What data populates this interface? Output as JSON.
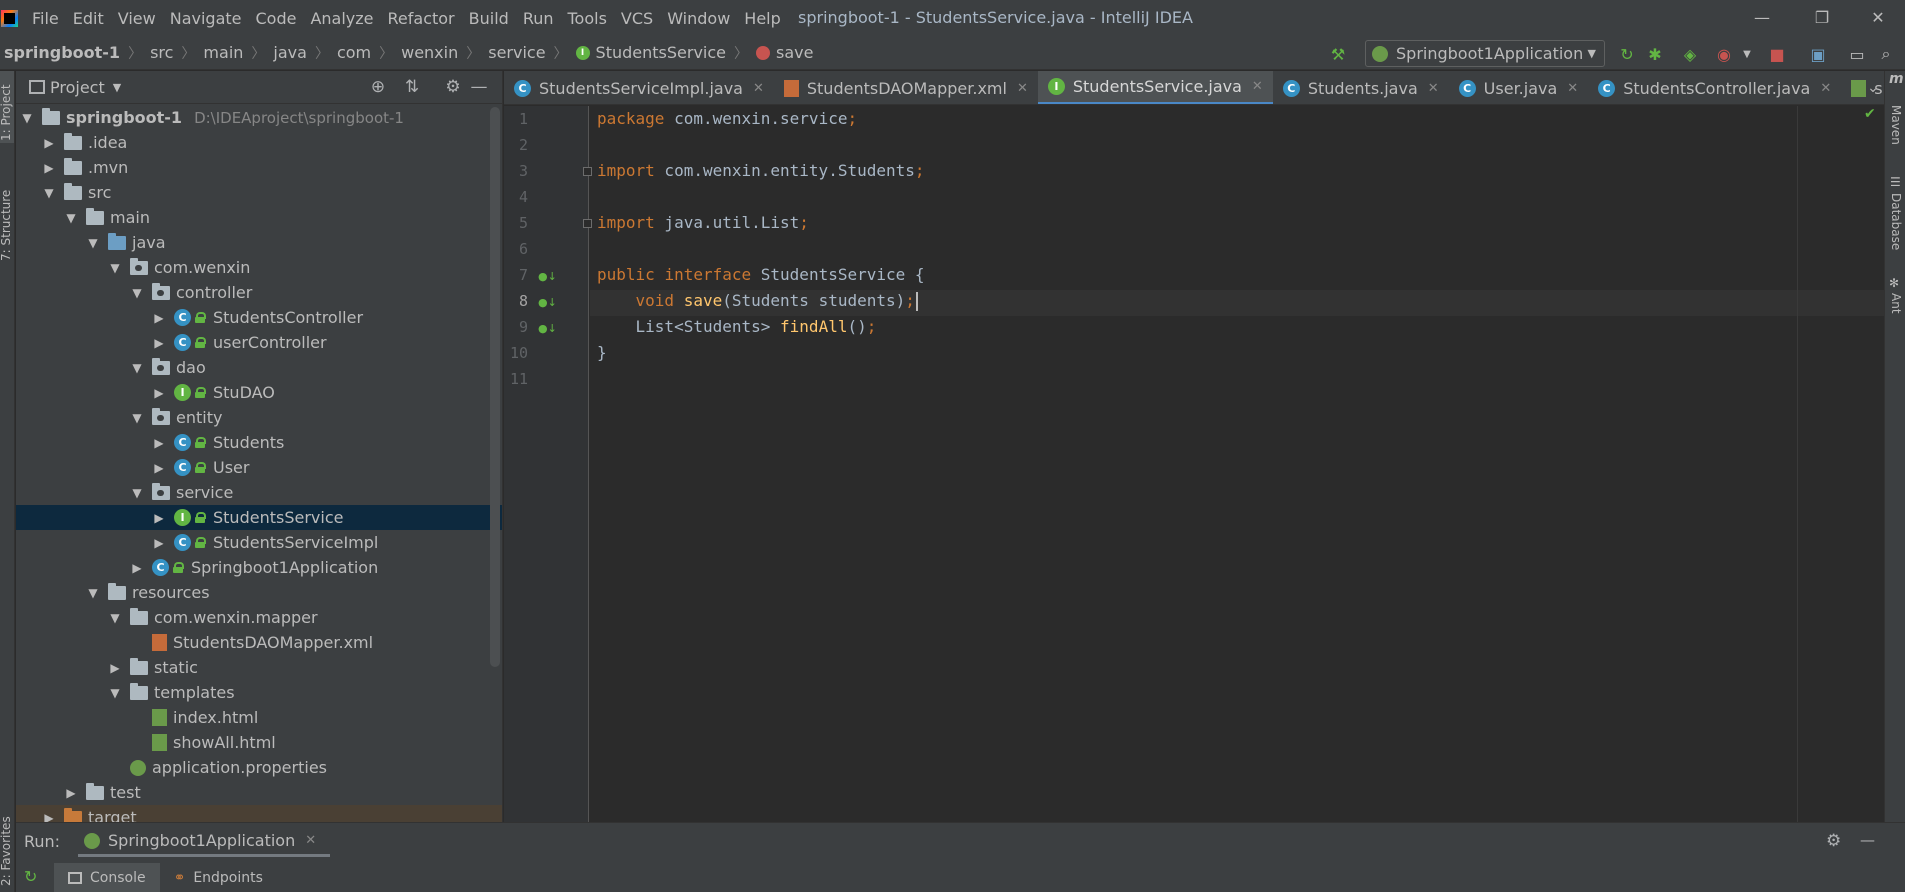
{
  "window": {
    "title": "springboot-1 - StudentsService.java - IntelliJ IDEA",
    "controls": [
      "—",
      "❐",
      "✕"
    ]
  },
  "menu": [
    "File",
    "Edit",
    "View",
    "Navigate",
    "Code",
    "Analyze",
    "Refactor",
    "Build",
    "Run",
    "Tools",
    "VCS",
    "Window",
    "Help"
  ],
  "breadcrumb": [
    "springboot-1",
    "src",
    "main",
    "java",
    "com",
    "wenxin",
    "service",
    "StudentsService",
    "save"
  ],
  "toolbar": {
    "run_config": "Springboot1Application"
  },
  "left_strip": {
    "tabs": [
      "1: Project",
      "7: Structure",
      "2: Favorites"
    ]
  },
  "project_panel": {
    "title": "Project",
    "tree": [
      {
        "label": "springboot-1",
        "path": "D:\\IDEAproject\\springboot-1"
      },
      {
        "label": ".idea"
      },
      {
        "label": ".mvn"
      },
      {
        "label": "src"
      },
      {
        "label": "main"
      },
      {
        "label": "java"
      },
      {
        "label": "com.wenxin"
      },
      {
        "label": "controller"
      },
      {
        "label": "StudentsController"
      },
      {
        "label": "userController"
      },
      {
        "label": "dao"
      },
      {
        "label": "StuDAO"
      },
      {
        "label": "entity"
      },
      {
        "label": "Students"
      },
      {
        "label": "User"
      },
      {
        "label": "service"
      },
      {
        "label": "StudentsService"
      },
      {
        "label": "StudentsServiceImpl"
      },
      {
        "label": "Springboot1Application"
      },
      {
        "label": "resources"
      },
      {
        "label": "com.wenxin.mapper"
      },
      {
        "label": "StudentsDAOMapper.xml"
      },
      {
        "label": "static"
      },
      {
        "label": "templates"
      },
      {
        "label": "index.html"
      },
      {
        "label": "showAll.html"
      },
      {
        "label": "application.properties"
      },
      {
        "label": "test"
      },
      {
        "label": "target"
      }
    ]
  },
  "editor_tabs": [
    {
      "label": "StudentsServiceImpl.java"
    },
    {
      "label": "StudentsDAOMapper.xml"
    },
    {
      "label": "StudentsService.java"
    },
    {
      "label": "Students.java"
    },
    {
      "label": "User.java"
    },
    {
      "label": "StudentsController.java"
    },
    {
      "label": "showAll.htr"
    }
  ],
  "editor": {
    "line_numbers": [
      "1",
      "2",
      "3",
      "4",
      "5",
      "6",
      "7",
      "8",
      "9",
      "10",
      "11"
    ],
    "code": {
      "l1_kw": "package",
      "l1_rest": " com.wenxin.service",
      "semi": ";",
      "l3_kw": "import",
      "l3_rest": " com.wenxin.entity.Students",
      "l5_kw": "import",
      "l5_rest": " java.util.List",
      "l7_kw1": "public",
      "l7_kw2": "interface",
      "l7_rest": " StudentsService {",
      "l8_kw": "void",
      "l8_fn": "save",
      "l8_rest": "(Students students)",
      "l9_type": "List<Students> ",
      "l9_fn": "findAll",
      "l9_rest": "()",
      "l10": "}"
    }
  },
  "right_strip": {
    "tabs": [
      "Maven",
      "Database",
      "Ant"
    ]
  },
  "run_panel": {
    "label": "Run:",
    "tab": "Springboot1Application",
    "subtabs": [
      "Console",
      "Endpoints"
    ]
  }
}
